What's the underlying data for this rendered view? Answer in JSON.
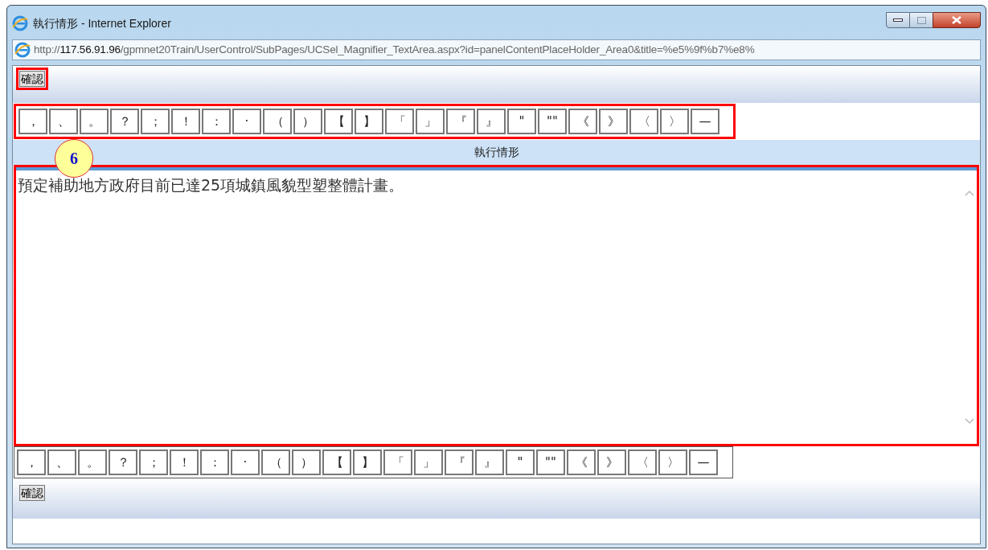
{
  "window": {
    "title": "執行情形 - Internet Explorer"
  },
  "address_bar": {
    "url_prefix": "http://",
    "url_host": "117.56.91.96",
    "url_path": "/gpmnet20Train/UserControl/SubPages/UCSel_Magnifier_TextArea.aspx?id=panelContentPlaceHolder_Area0&title=%e5%9f%b7%e8%"
  },
  "top_confirm_button": "確認",
  "top_keys": [
    "，",
    "、",
    "。",
    "？",
    "；",
    "！",
    "：",
    "·",
    "（",
    "）",
    "【",
    "】",
    "「",
    "」",
    "『",
    "』",
    "\"",
    "\"\"",
    "《",
    "》",
    "〈",
    "〉",
    "—"
  ],
  "section_header": "執行情形",
  "text_area": {
    "value": "預定補助地方政府目前已達25項城鎮風貌型塑整體計畫。"
  },
  "bottom_keys": [
    "，",
    "、",
    "。",
    "？",
    "；",
    "！",
    "：",
    "·",
    "（",
    "）",
    "【",
    "】",
    "「",
    "」",
    "『",
    "』",
    "\"",
    "\"\"",
    "《",
    "》",
    "〈",
    "〉",
    "—"
  ],
  "bottom_confirm_button": "確認",
  "annotation": {
    "badge": "6"
  }
}
